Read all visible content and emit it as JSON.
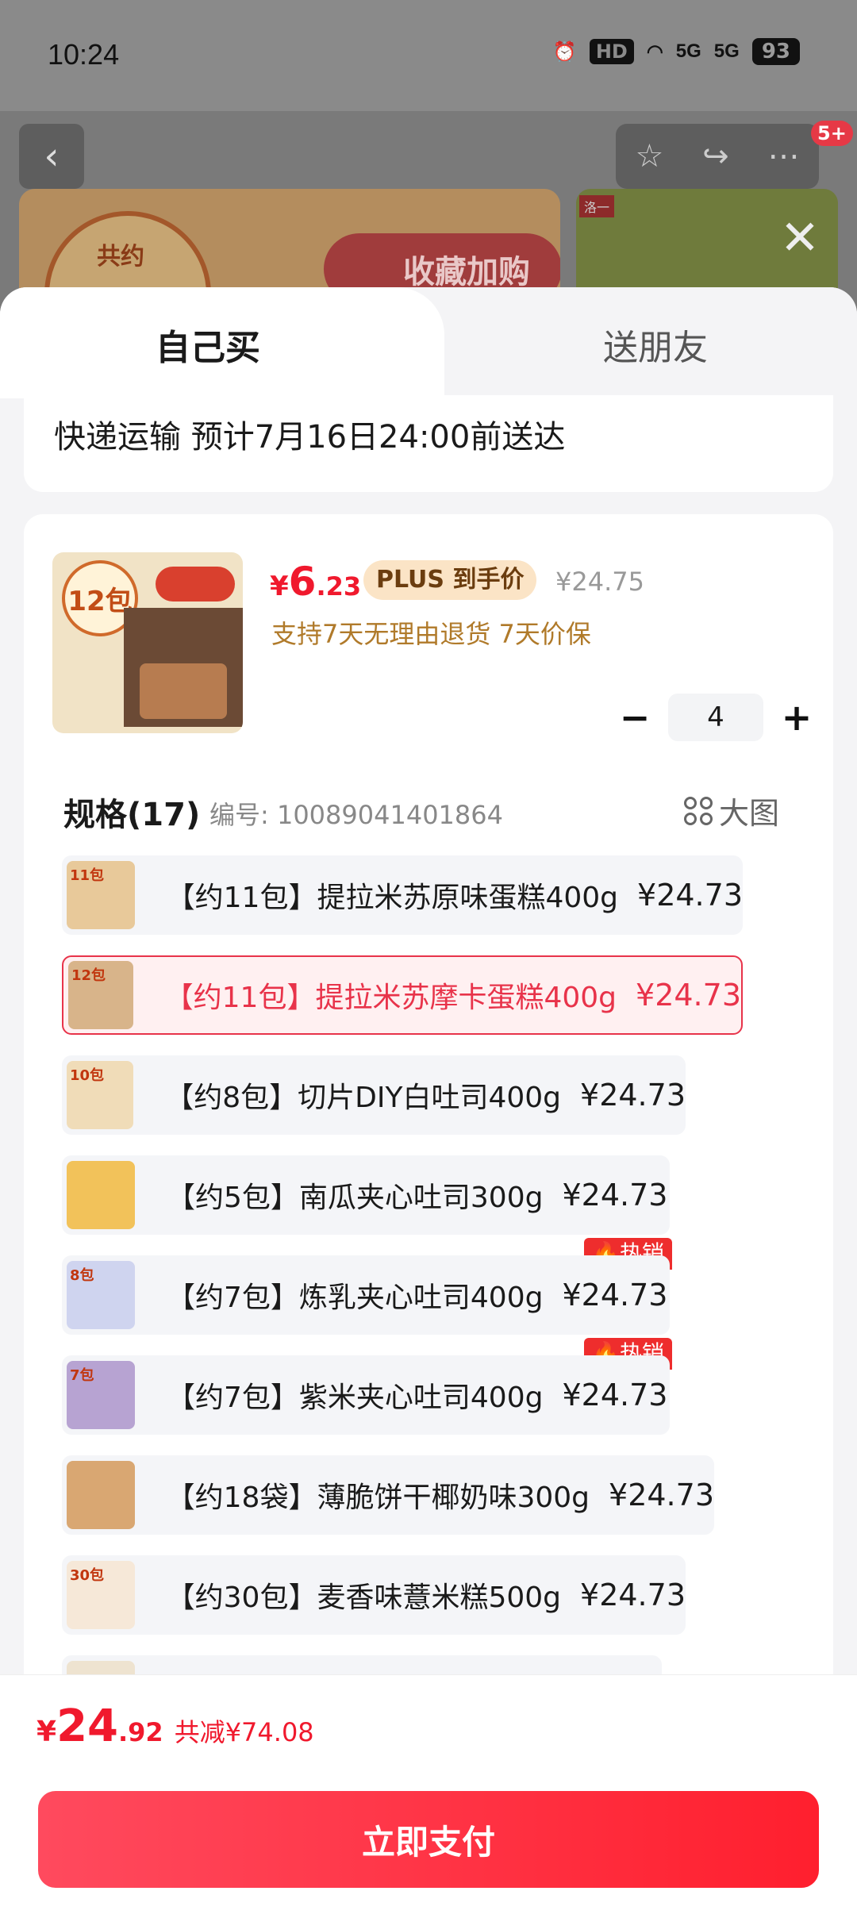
{
  "status": {
    "time": "10:24",
    "hd": "HD",
    "net1": "5G",
    "net2": "5G",
    "battery": "93"
  },
  "nav": {
    "badge": "5+"
  },
  "banner": {
    "circle_text": "共约",
    "red_text": "收藏加购",
    "photo_tag": "洛一"
  },
  "tabs": {
    "self": "自己买",
    "friend": "送朋友"
  },
  "shipping": {
    "text": "快递运输 预计7月16日24:00前送达"
  },
  "product": {
    "thumb_label": "12包",
    "price_currency": "¥",
    "price_int": "6",
    "price_dec": ".23",
    "plus_label": "PLUS 到手价",
    "original_price": "¥24.75",
    "return_policy": "支持7天无理由退货 7天价保",
    "quantity": "4",
    "minus": "−",
    "plus": "+"
  },
  "spec": {
    "title": "规格(17)",
    "code": "编号: 10089041401864",
    "big_image": "大图",
    "options": [
      {
        "label": "【约11包】提拉米苏原味蛋糕400g",
        "price": "¥24.73",
        "thumb": "11包"
      },
      {
        "label": "【约11包】提拉米苏摩卡蛋糕400g",
        "price": "¥24.73",
        "thumb": "12包"
      },
      {
        "label": "【约8包】切片DIY白吐司400g",
        "price": "¥24.73",
        "thumb": "10包"
      },
      {
        "label": "【约5包】南瓜夹心吐司300g",
        "price": "¥24.73",
        "thumb": ""
      },
      {
        "label": "【约7包】炼乳夹心吐司400g",
        "price": "¥24.73",
        "thumb": "8包",
        "hot": "热销"
      },
      {
        "label": "【约7包】紫米夹心吐司400g",
        "price": "¥24.73",
        "thumb": "7包",
        "hot": "热销"
      },
      {
        "label": "【约18袋】薄脆饼干椰奶味300g",
        "price": "¥24.73",
        "thumb": ""
      },
      {
        "label": "【约30包】麦香味薏米糕500g",
        "price": "¥24.73",
        "thumb": "30包"
      }
    ]
  },
  "footer": {
    "currency": "¥",
    "total_int": "24",
    "total_dec": ".92",
    "saved": "共减¥74.08",
    "pay_button": "立即支付"
  }
}
